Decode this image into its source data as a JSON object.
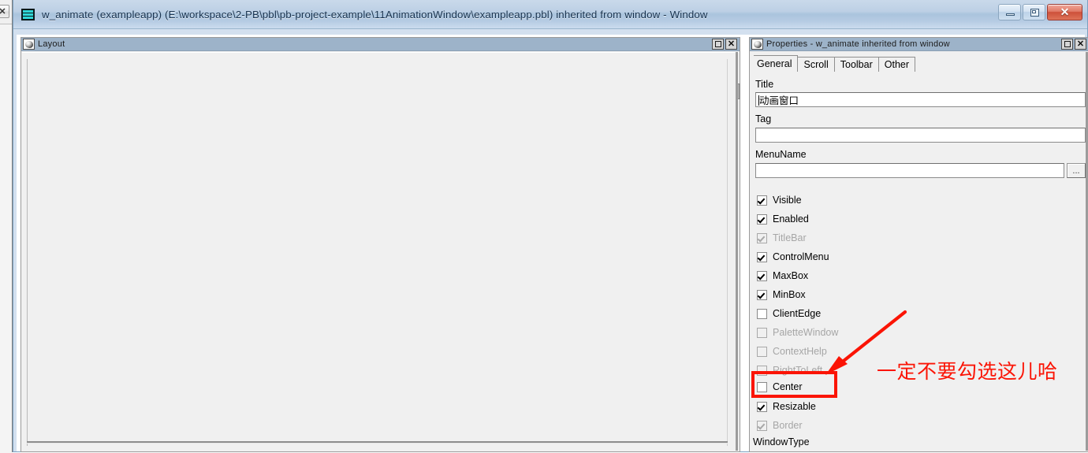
{
  "window": {
    "title": "w_animate (exampleapp) (E:\\workspace\\2-PB\\pbl\\pb-project-example\\11AnimationWindow\\exampleapp.pbl) inherited from window - Window",
    "icon": "powerbuilder-window-icon",
    "controls": {
      "minimize": "minimize-button",
      "maximize": "maximize-button",
      "close_label": "✕"
    }
  },
  "layout_panel": {
    "title": "Layout",
    "icon": "powerbuilder-painter-icon",
    "buttons": {
      "maximize": "□",
      "close": "✕"
    }
  },
  "properties_panel": {
    "title": "Properties - w_animate inherited from window",
    "icon": "powerbuilder-painter-icon",
    "buttons": {
      "maximize": "□",
      "close": "✕"
    },
    "tabs": [
      {
        "label": "General",
        "active": true
      },
      {
        "label": "Scroll",
        "active": false
      },
      {
        "label": "Toolbar",
        "active": false
      },
      {
        "label": "Other",
        "active": false
      }
    ],
    "fields": [
      {
        "label": "Title",
        "value": "动画窗口",
        "placeholder": "",
        "has_browse": false
      },
      {
        "label": "Tag",
        "value": "",
        "placeholder": "",
        "has_browse": false
      },
      {
        "label": "MenuName",
        "value": "",
        "placeholder": "",
        "has_browse": true,
        "browse_label": "..."
      }
    ],
    "browse_button_label": "...",
    "checkboxes": [
      {
        "label": "Visible",
        "checked": true,
        "enabled": true
      },
      {
        "label": "Enabled",
        "checked": true,
        "enabled": true
      },
      {
        "label": "TitleBar",
        "checked": true,
        "enabled": false
      },
      {
        "label": "ControlMenu",
        "checked": true,
        "enabled": true
      },
      {
        "label": "MaxBox",
        "checked": true,
        "enabled": true
      },
      {
        "label": "MinBox",
        "checked": true,
        "enabled": true
      },
      {
        "label": "ClientEdge",
        "checked": false,
        "enabled": true
      },
      {
        "label": "PaletteWindow",
        "checked": false,
        "enabled": false
      },
      {
        "label": "ContextHelp",
        "checked": false,
        "enabled": false
      },
      {
        "label": "RightToLeft",
        "checked": false,
        "enabled": false
      },
      {
        "label": "Center",
        "checked": false,
        "enabled": true
      },
      {
        "label": "Resizable",
        "checked": true,
        "enabled": true
      },
      {
        "label": "Border",
        "checked": true,
        "enabled": false
      }
    ],
    "bottom_label": "WindowType"
  },
  "annotation": {
    "text": "一定不要勾选这儿哈",
    "color": "#fb1405",
    "highlight_target": "Center",
    "arrow": "red-arrow-pointing-to-center-checkbox",
    "box": "red-rectangle-around-center-checkbox"
  },
  "colors": {
    "titlebar_text": "#16314e",
    "child_titlebar": "#9db3c9",
    "panel_bg": "#f0f0f0",
    "annotation_red": "#fb1405",
    "disabled_text": "#a6a6a6"
  }
}
